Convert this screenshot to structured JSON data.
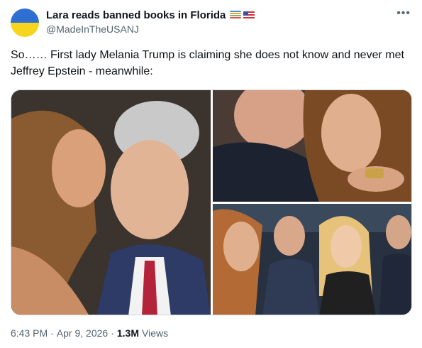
{
  "author": {
    "display_name": "Lara reads banned books in Florida",
    "handle": "@MadeInTheUSANJ",
    "avatar_icon": "ukraine-flag-avatar",
    "badges": [
      "books-emoji-icon",
      "us-flag-icon"
    ]
  },
  "tweet": {
    "text": "So…… First lady Melania Trump is claiming she does not know and never met Jeffrey Epstein - meanwhile:"
  },
  "media": {
    "count": 3,
    "photos": [
      "photo-1",
      "photo-2",
      "photo-3"
    ]
  },
  "meta": {
    "time": "6:43 PM",
    "separator": "·",
    "date": "Apr 9, 2026",
    "views_count": "1.3M",
    "views_label": "Views"
  },
  "menu": {
    "more_icon": "more-icon"
  },
  "colors": {
    "text": "#0f1419",
    "secondary": "#536471",
    "border": "#cfd9de"
  }
}
